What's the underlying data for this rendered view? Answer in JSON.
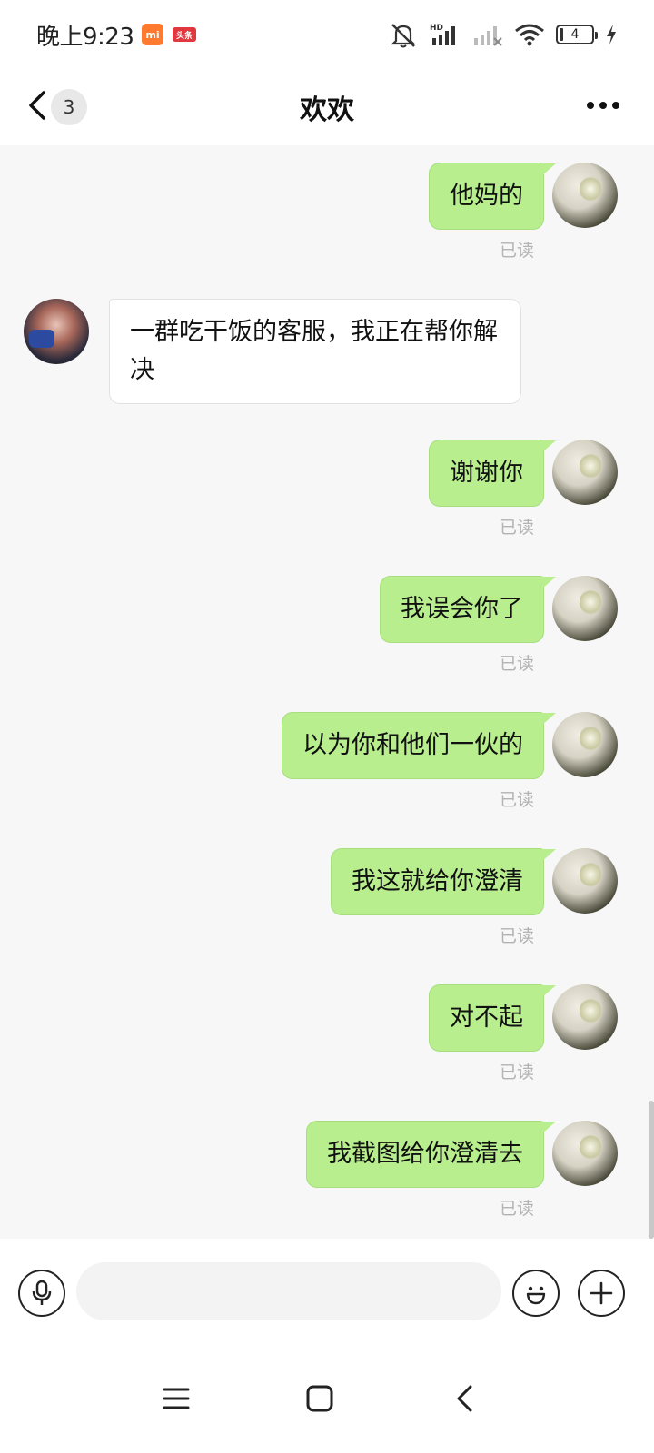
{
  "status_bar": {
    "time": "晚上9:23",
    "badge_mi": "mi",
    "badge_toutiao": "头条",
    "battery_level": "4"
  },
  "nav": {
    "unread_count": "3",
    "title": "欢欢"
  },
  "messages": [
    {
      "sender": "me",
      "text": "他妈的",
      "read": "已读"
    },
    {
      "sender": "other",
      "text": "一群吃干饭的客服，我正在帮你解决"
    },
    {
      "sender": "me",
      "text": "谢谢你",
      "read": "已读"
    },
    {
      "sender": "me",
      "text": "我误会你了",
      "read": "已读"
    },
    {
      "sender": "me",
      "text": "以为你和他们一伙的",
      "read": "已读"
    },
    {
      "sender": "me",
      "text": "我这就给你澄清",
      "read": "已读"
    },
    {
      "sender": "me",
      "text": "对不起",
      "read": "已读"
    },
    {
      "sender": "me",
      "text": "我截图给你澄清去",
      "read": "已读"
    }
  ],
  "input": {
    "value": "",
    "placeholder": ""
  },
  "colors": {
    "my_bubble": "#b8ee8e",
    "other_bubble": "#ffffff",
    "chat_background": "#f7f7f7",
    "read_receipt": "#b3b3b3"
  },
  "icons": {
    "back": "chevron-left-icon",
    "more": "more-dots-icon",
    "voice": "microphone-icon",
    "emoji": "smile-icon",
    "plus": "plus-icon",
    "sys_menu": "menu-icon",
    "sys_home": "home-square-icon",
    "sys_back": "back-chevron-icon"
  }
}
